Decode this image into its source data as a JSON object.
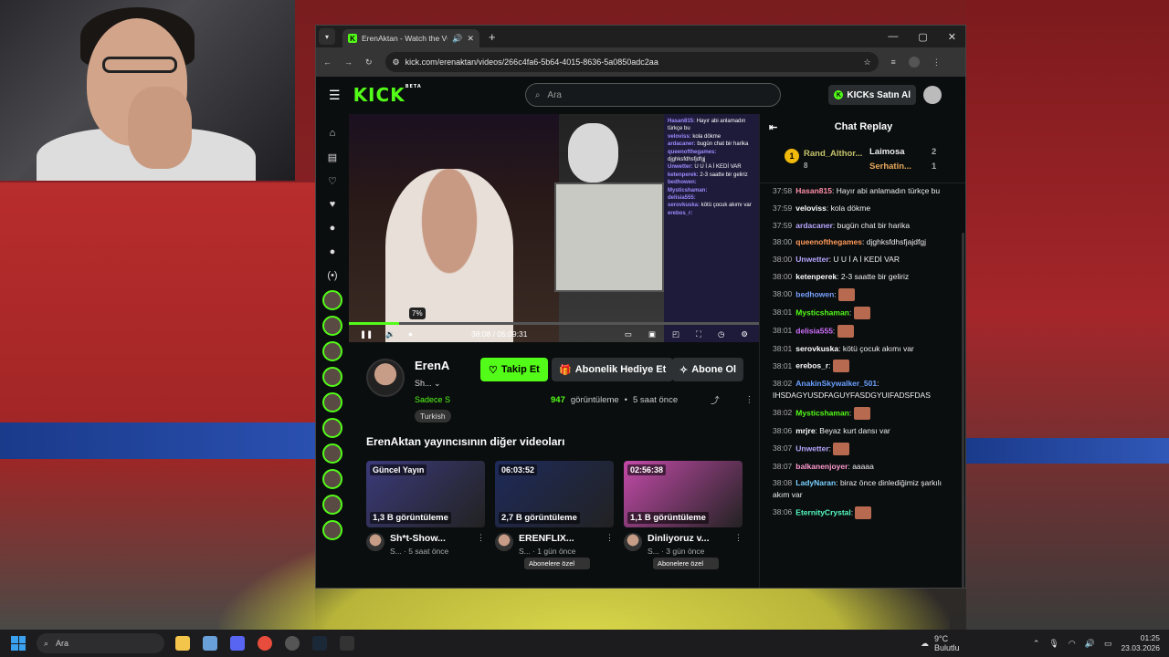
{
  "browser": {
    "tab_title": "ErenAktan - Watch the VOD",
    "url": "kick.com/erenaktan/videos/266c4fa6-5b64-4015-8636-5a0850adc2aa",
    "new_tab": "+",
    "controls": [
      "—",
      "▢",
      "✕"
    ]
  },
  "header": {
    "logo": "KICK",
    "logo_badge": "BETA",
    "search_placeholder": "Ara",
    "kicks_button": "KICKs Satın Al"
  },
  "player": {
    "volume_tooltip": "7%",
    "time_current": "38:08",
    "time_separator": "/",
    "time_total": "05:09:31",
    "progress_fraction": 0.123,
    "overlay_chat": [
      {
        "u": "Hasan815",
        "m": "Hayır abi anlamadın türkçe bu"
      },
      {
        "u": "veloviss",
        "m": "kola dökme"
      },
      {
        "u": "ardacaner",
        "m": "bugün chat bir harika"
      },
      {
        "u": "queenofthegames",
        "m": "djghksfdhsfjdfgj"
      },
      {
        "u": "Unwetter",
        "m": "U U İ A İ KEDİ VAR"
      },
      {
        "u": "ketenperek",
        "m": "2-3 saatte bir geliriz"
      },
      {
        "u": "bedhowen",
        "m": ""
      },
      {
        "u": "Mysticshaman",
        "m": ""
      },
      {
        "u": "delisia555",
        "m": ""
      },
      {
        "u": "serovkuska",
        "m": "kötü çocuk akımı var"
      },
      {
        "u": "erebos_r",
        "m": ""
      }
    ]
  },
  "channel": {
    "name": "ErenA",
    "title": "Sh...",
    "subtitle": "Sadece S",
    "tag": "Turkish",
    "follow_label": "Takip Et",
    "gift_label": "Abonelik Hediye Et",
    "subscribe_label": "Abone Ol",
    "views": "947",
    "views_label": "görüntüleme",
    "time_ago": "5 saat önce"
  },
  "other_videos": {
    "heading": "ErenAktan yayıncısının diğer videoları",
    "items": [
      {
        "corner": "Güncel Yayın",
        "views": "1,3 B görüntüleme",
        "title": "Sh*t-Show...",
        "meta": "S... · 5 saat önce",
        "badge": "",
        "color": "#3b3a7a"
      },
      {
        "corner": "06:03:52",
        "views": "2,7 B görüntüleme",
        "title": "ERENFLIX...",
        "meta": "S... · 1 gün önce",
        "badge": "Abonelere özel",
        "color": "#1e2a5a"
      },
      {
        "corner": "02:56:38",
        "views": "1,1 B görüntüleme",
        "title": "Dinliyoruz v...",
        "meta": "S... · 3 gün önce",
        "badge": "Abonelere özel",
        "color": "#c24aa8"
      }
    ]
  },
  "chat": {
    "title": "Chat Replay",
    "leaderboard": [
      {
        "rank": "1",
        "name": "Rand_Althor...",
        "count": "8"
      },
      {
        "name": "Laimosa",
        "count": "2"
      },
      {
        "name": "Serhatin...",
        "count": "1"
      }
    ],
    "messages": [
      {
        "t": "37:58",
        "u": "Hasan815",
        "m": "Hayır abi anlamadın türkçe bu",
        "c": "#ff8fa8"
      },
      {
        "t": "37:59",
        "u": "veloviss",
        "m": "kola dökme",
        "c": "#ffffff"
      },
      {
        "t": "37:59",
        "u": "ardacaner",
        "m": "bugün chat bir harika",
        "c": "#b6a6ff"
      },
      {
        "t": "38:00",
        "u": "queenofthegames",
        "m": "djghksfdhsfjajdfgj",
        "c": "#ff9a5a"
      },
      {
        "t": "38:00",
        "u": "Unwetter",
        "m": "U U İ A İ KEDİ VAR",
        "c": "#b6a6ff"
      },
      {
        "t": "38:00",
        "u": "ketenperek",
        "m": "2-3 saatte bir geliriz",
        "c": "#ffffff"
      },
      {
        "t": "38:00",
        "u": "bedhowen",
        "m": "",
        "c": "#7aa2ff"
      },
      {
        "t": "38:01",
        "u": "Mysticshaman",
        "m": "",
        "c": "#53fc18"
      },
      {
        "t": "38:01",
        "u": "delisia555",
        "m": "",
        "c": "#d070ff"
      },
      {
        "t": "38:01",
        "u": "serovkuska",
        "m": "kötü çocuk akımı var",
        "c": "#ffffff"
      },
      {
        "t": "38:01",
        "u": "erebos_r",
        "m": "",
        "c": "#ffffff"
      },
      {
        "t": "38:02",
        "u": "AnakinSkywalker_501",
        "m": "IHSDAGYUSDFAGUYFASDGYUIFADSFDAS",
        "c": "#6aa0ff"
      },
      {
        "t": "38:02",
        "u": "Mysticshaman",
        "m": "",
        "c": "#53fc18"
      },
      {
        "t": "38:06",
        "u": "mrjre",
        "m": "Beyaz kurt dansı var",
        "c": "#ffffff"
      },
      {
        "t": "38:07",
        "u": "Unwetter",
        "m": "",
        "c": "#b6a6ff"
      },
      {
        "t": "38:07",
        "u": "balkanenjoyer",
        "m": "aaaaa",
        "c": "#ff9ad0"
      },
      {
        "t": "38:08",
        "u": "LadyNaran",
        "m": "biraz önce dinlediğimiz şarkılı akım var",
        "c": "#7ad0ff"
      },
      {
        "t": "38:06",
        "u": "EternityCrystal",
        "m": "",
        "c": "#53fcc0"
      }
    ]
  },
  "taskbar": {
    "search": "Ara",
    "temp": "9°C",
    "weather": "Bulutlu",
    "time": "01:25",
    "date": "23.03.2026"
  }
}
